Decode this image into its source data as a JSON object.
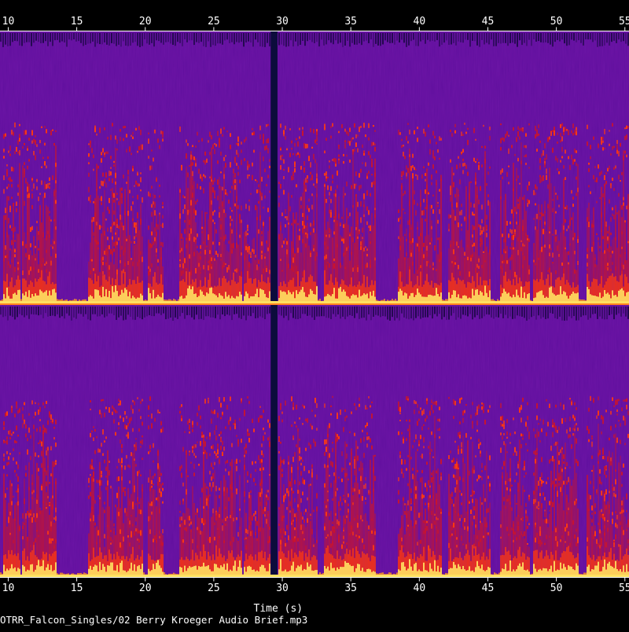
{
  "chart_data": {
    "type": "heatmap",
    "subtype": "spectrogram",
    "channels": 2,
    "x": {
      "label": "Time (s)",
      "range": [
        9.4,
        55.3
      ],
      "ticks": [
        10,
        15,
        20,
        25,
        30,
        35,
        40,
        45,
        50,
        55
      ],
      "tick_labels": [
        "10",
        "15",
        "20",
        "25",
        "30",
        "35",
        "40",
        "45",
        "50",
        "55"
      ]
    },
    "grid": false,
    "colormap": [
      "#000000",
      "#1a0a5c",
      "#5a10a0",
      "#7a18a8",
      "#c8142e",
      "#ff3a10",
      "#ff9a20",
      "#ffe060",
      "#ffffc0"
    ],
    "background_level": 0.35,
    "silence_gaps_s": [
      [
        29.15,
        29.65
      ]
    ],
    "speech_segments_s": [
      [
        9.6,
        10.8
      ],
      [
        10.9,
        13.5
      ],
      [
        15.8,
        19.8
      ],
      [
        20.1,
        21.3
      ],
      [
        22.4,
        27.0
      ],
      [
        27.1,
        29.1
      ],
      [
        29.7,
        32.5
      ],
      [
        33.0,
        36.8
      ],
      [
        38.4,
        41.6
      ],
      [
        42.1,
        45.2
      ],
      [
        45.8,
        48.0
      ],
      [
        48.2,
        51.6
      ],
      [
        52.2,
        55.3
      ]
    ],
    "footer": "OTRR_Falcon_Singles/02 Berry Kroeger Audio Brief.mp3"
  }
}
